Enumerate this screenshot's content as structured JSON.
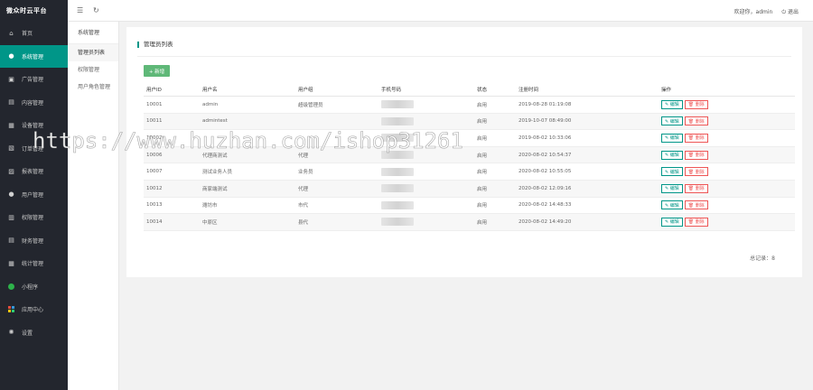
{
  "brand": "微众时云平台",
  "nav": [
    {
      "label": "首页",
      "icon": "home-icon",
      "glyph": "⌂"
    },
    {
      "label": "系统管理",
      "icon": "user-icon",
      "glyph": "●"
    },
    {
      "label": "广告管理",
      "icon": "ad-icon",
      "glyph": "▣"
    },
    {
      "label": "内容管理",
      "icon": "content-icon",
      "glyph": "▤"
    },
    {
      "label": "设备管理",
      "icon": "device-icon",
      "glyph": "▦"
    },
    {
      "label": "订单管理",
      "icon": "order-icon",
      "glyph": "▧"
    },
    {
      "label": "报表管理",
      "icon": "report-icon",
      "glyph": "▨"
    },
    {
      "label": "用户管理",
      "icon": "users-icon",
      "glyph": "●"
    },
    {
      "label": "权限管理",
      "icon": "permission-icon",
      "glyph": "▥"
    },
    {
      "label": "财务管理",
      "icon": "finance-icon",
      "glyph": "▤"
    },
    {
      "label": "统计管理",
      "icon": "stats-icon",
      "glyph": "▦"
    },
    {
      "label": "小程序",
      "icon": "miniapp-icon",
      "glyph": ""
    },
    {
      "label": "应用中心",
      "icon": "apps-icon",
      "glyph": ""
    },
    {
      "label": "设置",
      "icon": "gear-icon",
      "glyph": "✺"
    }
  ],
  "header": {
    "menu_glyph": "☰",
    "refresh_glyph": "↻",
    "welcome": "欢迎你，admin",
    "logout": "⏻ 退出"
  },
  "submenu": {
    "title": "系统管理",
    "items": [
      "管理员列表",
      "权限管理",
      "用户角色管理"
    ]
  },
  "card": {
    "title": "管理员列表",
    "add_button": "+ 新增"
  },
  "table": {
    "headers": [
      "用户ID",
      "用户名",
      "用户组",
      "手机号码",
      "状态",
      "注册时间",
      "操作"
    ],
    "rows": [
      [
        "10001",
        "admin",
        "超级管理员",
        "",
        "启用",
        "2019-08-28 01:19:08"
      ],
      [
        "10011",
        "admintest",
        "",
        "",
        "启用",
        "2019-10-07 08:49:00"
      ],
      [
        "10002",
        "",
        "",
        "",
        "启用",
        "2019-08-02 10:33:06"
      ],
      [
        "10006",
        "代理商测试",
        "代理",
        "",
        "启用",
        "2020-08-02 10:54:37"
      ],
      [
        "10007",
        "测试业务人员",
        "业务员",
        "",
        "启用",
        "2020-08-02 10:55:05"
      ],
      [
        "10012",
        "商家端测试",
        "代理",
        "",
        "启用",
        "2020-08-02 12:09:16"
      ],
      [
        "10013",
        "潍坊市",
        "市代",
        "",
        "启用",
        "2020-08-02 14:48:33"
      ],
      [
        "10014",
        "中原区",
        "县代",
        "",
        "启用",
        "2020-08-02 14:49:20"
      ]
    ],
    "edit_label": "✎ 编辑",
    "delete_label": "🗑 删除"
  },
  "total": "总记录：8",
  "watermark": "https://www.huzhan.com/ishop31261",
  "colors": {
    "accent": "#009688",
    "sidebar": "#23262e",
    "add": "#5fb878",
    "danger": "#ee5555"
  }
}
